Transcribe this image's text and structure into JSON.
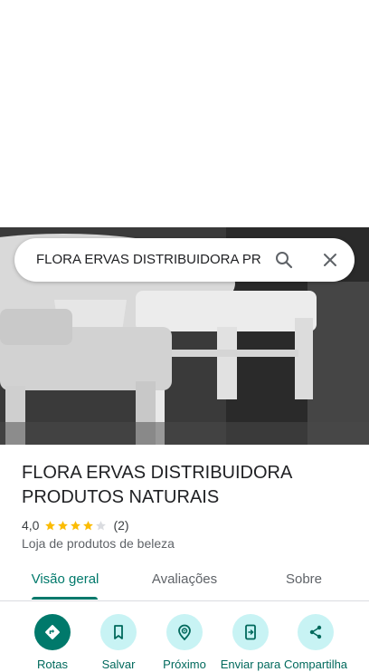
{
  "search": {
    "query": "FLORA ERVAS DISTRIBUIDORA PRODUTOS NATURAIS"
  },
  "place": {
    "name": "FLORA ERVAS DISTRIBUIDORA PRODUTOS NATURAIS",
    "rating": "4,0",
    "rating_stars": 4,
    "rating_max": 5,
    "reviews_count": "(2)",
    "category": "Loja de produtos de beleza"
  },
  "tabs": [
    {
      "label": "Visão geral",
      "active": true
    },
    {
      "label": "Avaliações",
      "active": false
    },
    {
      "label": "Sobre",
      "active": false
    }
  ],
  "actions": [
    {
      "label": "Rotas",
      "icon": "directions-icon"
    },
    {
      "label": "Salvar",
      "icon": "bookmark-icon"
    },
    {
      "label": "Próximo",
      "icon": "nearby-icon"
    },
    {
      "label": "Enviar para",
      "icon": "send-to-phone-icon"
    },
    {
      "label": "Compartilha",
      "icon": "share-icon"
    }
  ],
  "colors": {
    "accent": "#00796b",
    "action_bg": "#c8f3f4",
    "star": "#fbbc04",
    "star_empty": "#dadce0"
  }
}
